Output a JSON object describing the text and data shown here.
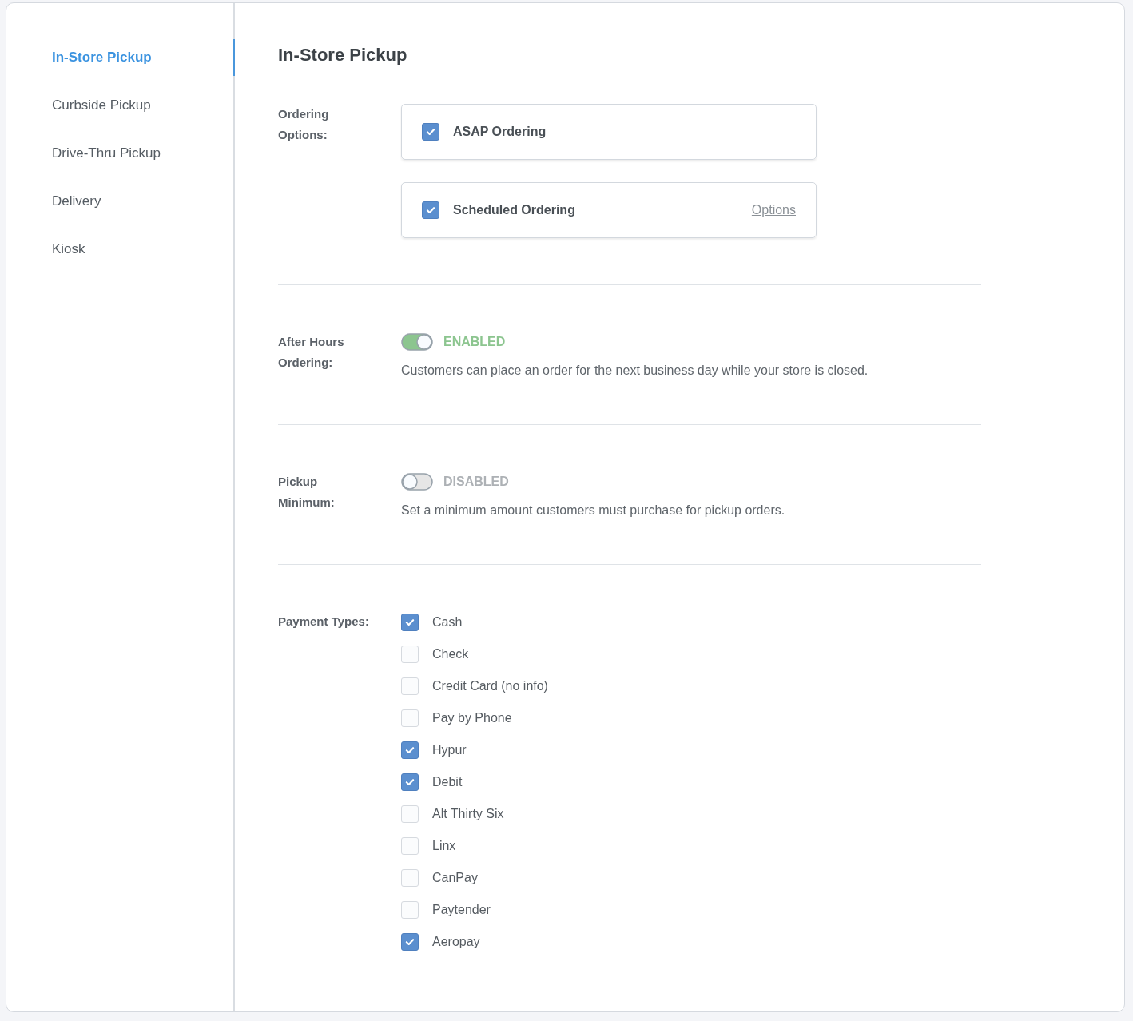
{
  "sidebar": {
    "items": [
      {
        "label": "In-Store Pickup",
        "selected": true
      },
      {
        "label": "Curbside Pickup",
        "selected": false
      },
      {
        "label": "Drive-Thru Pickup",
        "selected": false
      },
      {
        "label": "Delivery",
        "selected": false
      },
      {
        "label": "Kiosk",
        "selected": false
      }
    ]
  },
  "page_title": "In-Store Pickup",
  "sections": [
    {
      "kind": "option-cards",
      "label": "Ordering\nOptions:",
      "options": [
        {
          "label": "ASAP Ordering",
          "checked": true
        },
        {
          "label": "Scheduled Ordering",
          "checked": true,
          "link": "Options"
        }
      ]
    },
    {
      "kind": "toggle",
      "label": "After Hours\nOrdering:",
      "on": true,
      "status": "ENABLED",
      "description": "Customers can place an order for the next business day while your store is closed."
    },
    {
      "kind": "toggle",
      "label": "Pickup\nMinimum:",
      "on": false,
      "status": "DISABLED",
      "description": "Set a minimum amount customers must purchase for pickup orders."
    },
    {
      "kind": "checklist",
      "label": "Payment Types:",
      "items": [
        {
          "label": "Cash",
          "checked": true
        },
        {
          "label": "Check",
          "checked": false
        },
        {
          "label": "Credit Card (no info)",
          "checked": false
        },
        {
          "label": "Pay by Phone",
          "checked": false
        },
        {
          "label": "Hypur",
          "checked": true
        },
        {
          "label": "Debit",
          "checked": true
        },
        {
          "label": "Alt Thirty Six",
          "checked": false
        },
        {
          "label": "Linx",
          "checked": false
        },
        {
          "label": "CanPay",
          "checked": false
        },
        {
          "label": "Paytender",
          "checked": false
        },
        {
          "label": "Aeropay",
          "checked": true
        }
      ]
    }
  ]
}
